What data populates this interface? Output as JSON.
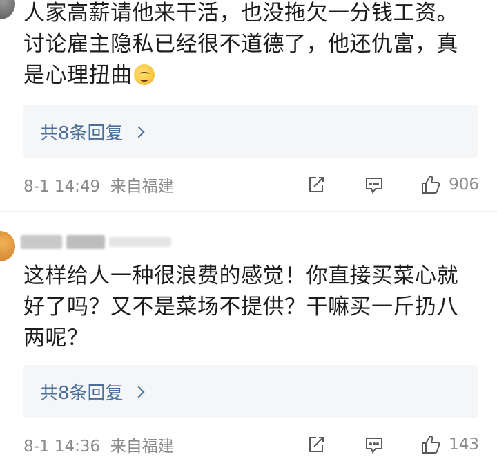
{
  "comments": [
    {
      "text": "人家高薪请他来干活，也没拖欠一分钱工资。讨论雇主隐私已经很不道德了，他还仇富，真是心理扭曲",
      "emoji": "smirk-emoji",
      "replies_label": "共8条回复",
      "meta": "8-1 14:49  来自福建",
      "likes": "906"
    },
    {
      "text": "这样给人一种很浪费的感觉！你直接买菜心就好了吗？又不是菜场不提供？干嘛买一斤扔八两呢？",
      "replies_label": "共8条回复",
      "meta": "8-1 14:36  来自福建",
      "likes": "143"
    }
  ]
}
